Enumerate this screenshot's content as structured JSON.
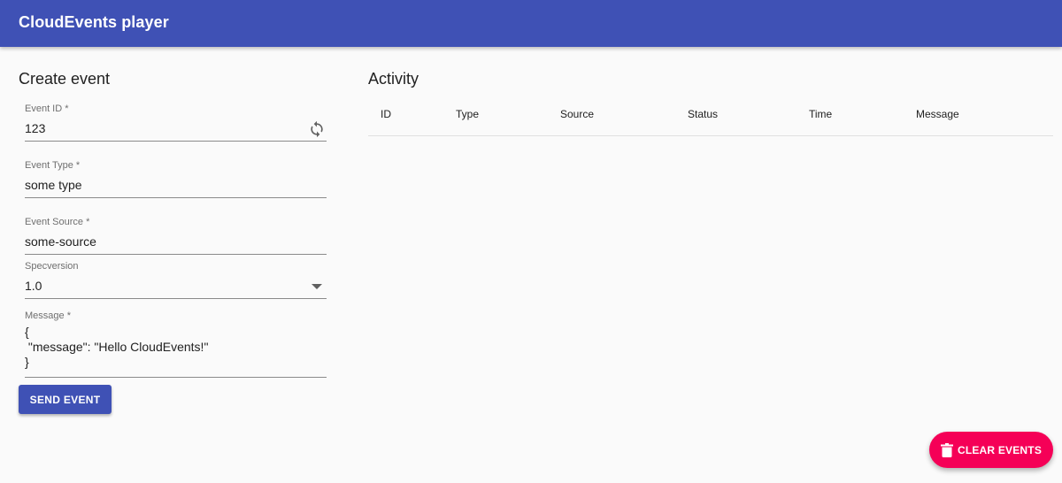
{
  "appbar": {
    "title": "CloudEvents player"
  },
  "form": {
    "title": "Create event",
    "event_id": {
      "label": "Event ID *",
      "value": "123",
      "icon": "refresh-icon"
    },
    "event_type": {
      "label": "Event Type *",
      "value": "some type"
    },
    "event_source": {
      "label": "Event Source *",
      "value": "some-source"
    },
    "specversion": {
      "label": "Specversion",
      "value": "1.0",
      "icon": "dropdown-arrow-icon"
    },
    "message": {
      "label": "Message *",
      "value": "{\n \"message\": \"Hello CloudEvents!\"\n}"
    },
    "send_label": "SEND EVENT"
  },
  "activity": {
    "title": "Activity",
    "columns": [
      "ID",
      "Type",
      "Source",
      "Status",
      "Time",
      "Message"
    ]
  },
  "fab": {
    "label": "CLEAR EVENTS",
    "icon": "trash-icon"
  },
  "colors": {
    "primary": "#3f51b5",
    "accent": "#f50057"
  }
}
